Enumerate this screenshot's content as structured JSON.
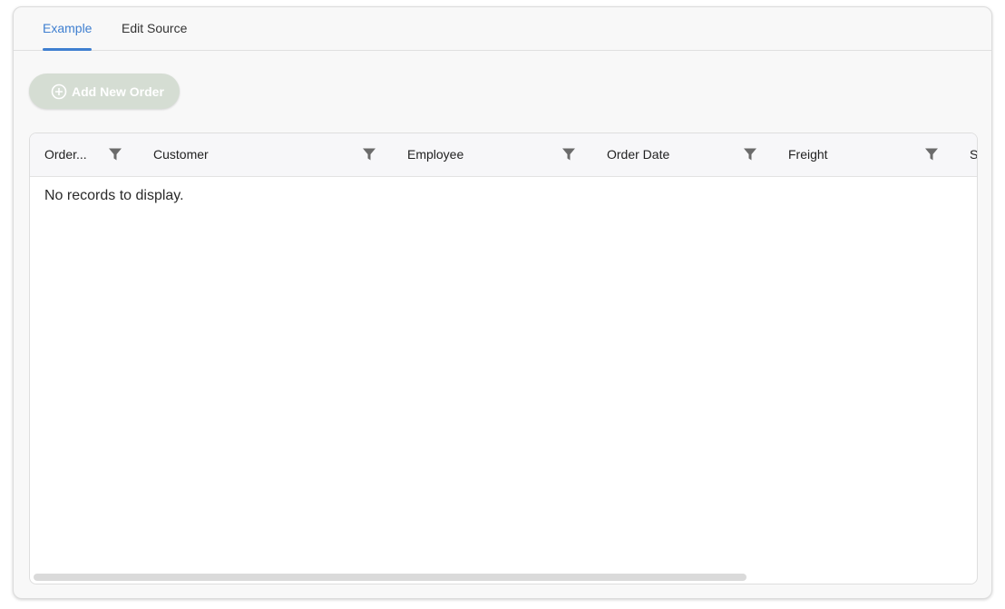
{
  "tabs": [
    {
      "label": "Example",
      "active": true
    },
    {
      "label": "Edit Source",
      "active": false
    }
  ],
  "toolbar": {
    "add_button_label": "Add New Order",
    "add_button_icon": "plus-circle-icon"
  },
  "grid": {
    "columns": [
      {
        "label": "Order..."
      },
      {
        "label": "Customer"
      },
      {
        "label": "Employee"
      },
      {
        "label": "Order Date"
      },
      {
        "label": "Freight"
      },
      {
        "label": "S"
      }
    ],
    "filter_icon": "funnel-icon",
    "empty_message": "No records to display."
  },
  "colors": {
    "accent": "#3f7fd0",
    "button_disabled_bg": "#d5ddd3",
    "filter_icon": "#6b6b6b"
  }
}
